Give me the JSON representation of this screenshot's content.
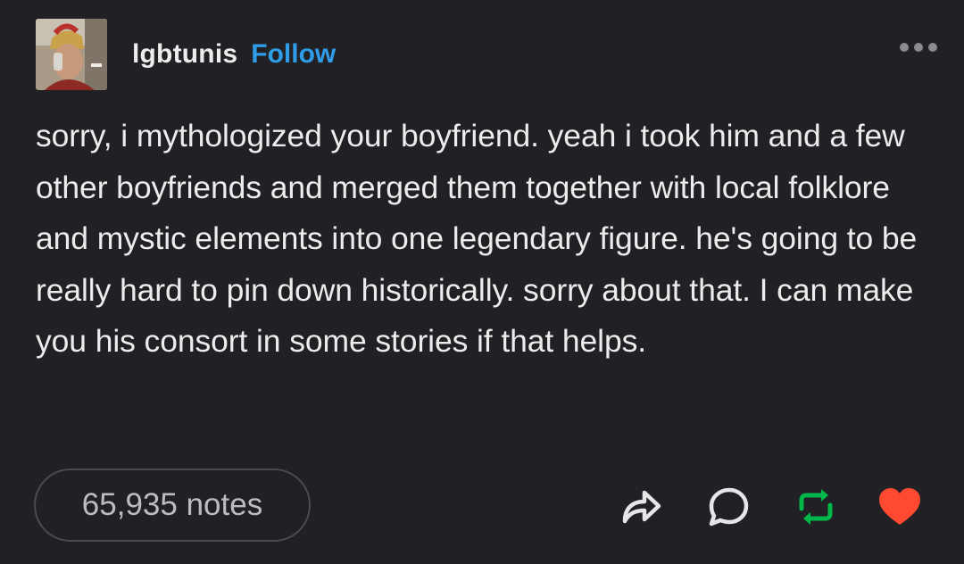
{
  "post": {
    "username": "lgbtunis",
    "follow_label": "Follow",
    "text": "sorry, i mythologized your boyfriend. yeah i took him and a few other boyfriends and merged them together with local folklore and mystic elements into one legendary figure. he's going to be really hard to pin down historically. sorry about that. I can make you his consort in some stories if that helps.",
    "notes_label": "65,935 notes"
  },
  "icons": {
    "more": "more-options-icon",
    "share": "share-icon",
    "reply": "reply-icon",
    "reblog": "reblog-icon",
    "like": "heart-icon"
  },
  "colors": {
    "background": "#212125",
    "text": "#ececec",
    "follow": "#2f9ce8",
    "reblog": "#00b84a",
    "like": "#ff4930",
    "muted": "#bdbdc0"
  }
}
